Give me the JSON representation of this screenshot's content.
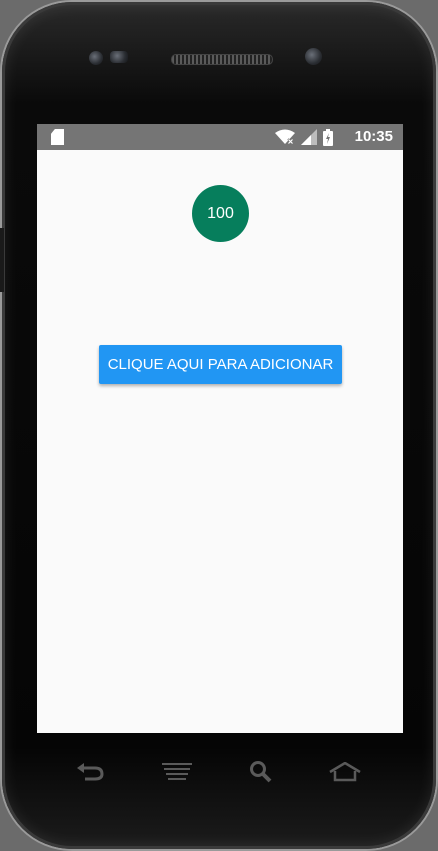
{
  "status_bar": {
    "time": "10:35",
    "icons": [
      "sd-card-icon",
      "wifi-icon",
      "signal-icon",
      "battery-icon"
    ]
  },
  "main": {
    "counter_value": "100",
    "counter_color": "#067e5c",
    "add_button_label": "CLIQUE AQUI PARA ADICIONAR",
    "add_button_color": "#2196f3"
  },
  "hardware_nav": {
    "buttons": [
      "back-icon",
      "menu-icon",
      "search-icon",
      "home-icon"
    ]
  }
}
